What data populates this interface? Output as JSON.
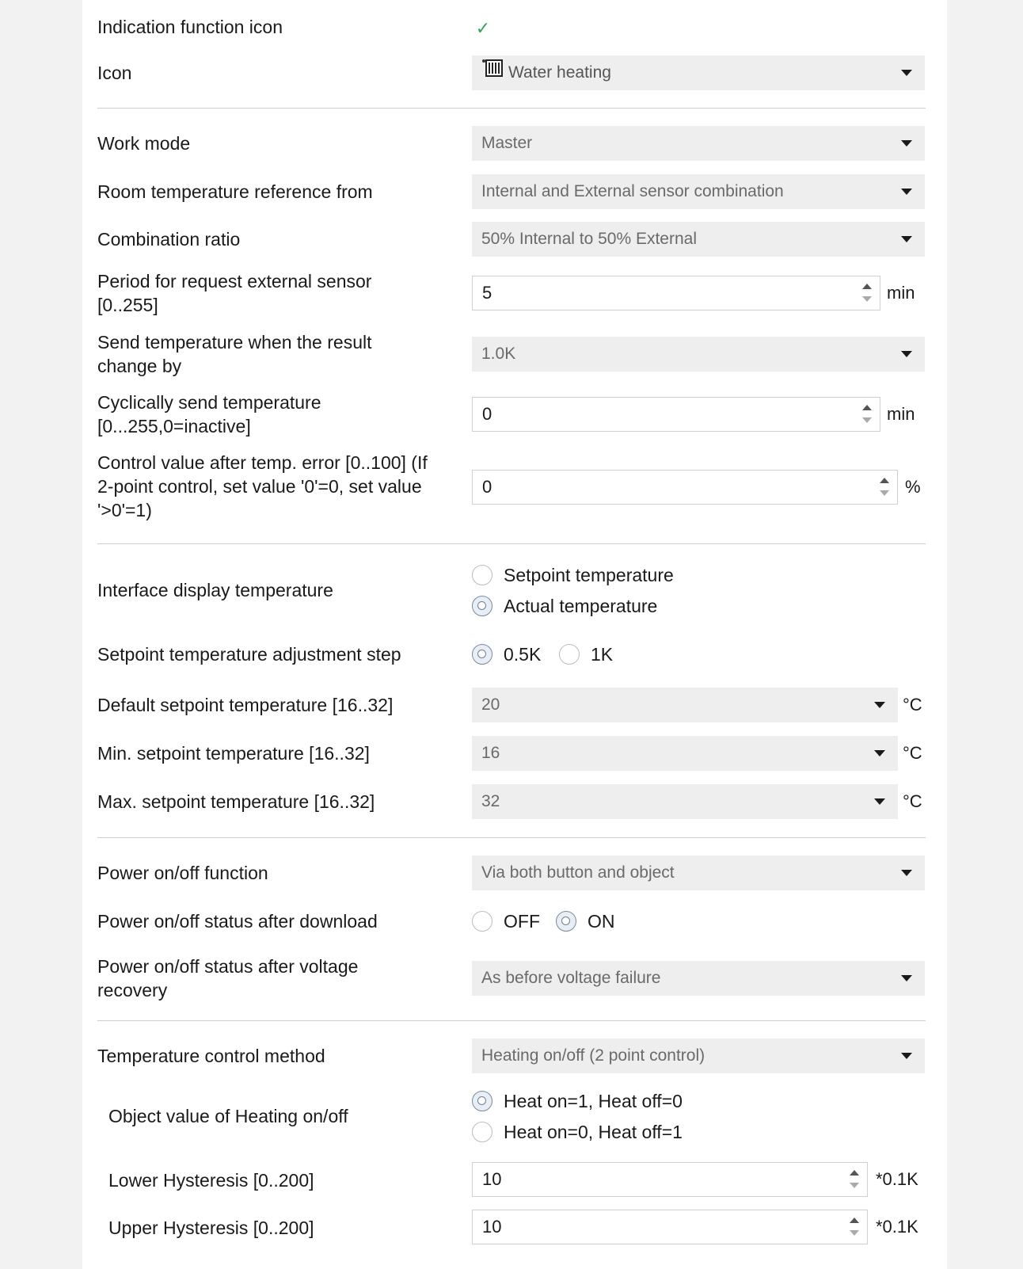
{
  "indication": {
    "label": "Indication function icon",
    "checked": true
  },
  "icon": {
    "label": "Icon",
    "value": "Water heating"
  },
  "work_mode": {
    "label": "Work mode",
    "value": "Master"
  },
  "room_ref": {
    "label": "Room temperature reference from",
    "value": "Internal and External sensor combination"
  },
  "combination": {
    "label": "Combination ratio",
    "value": "50% Internal to 50% External"
  },
  "period": {
    "label_1": "Period for request external sensor",
    "label_2": "[0..255]",
    "value": "5",
    "unit": "min"
  },
  "send_change": {
    "label_1": "Send temperature when the result",
    "label_2": "change by",
    "value": "1.0K"
  },
  "cyclic": {
    "label_1": "Cyclically send temperature",
    "label_2": "[0...255,0=inactive]",
    "value": "0",
    "unit": "min"
  },
  "control_err": {
    "label_1": "Control value after temp. error [0..100] (If",
    "label_2": "2-point control, set value '0'=0, set value",
    "label_3": "'>0'=1)",
    "value": "0",
    "unit": "%"
  },
  "display": {
    "label": "Interface display temperature",
    "options": [
      "Setpoint temperature",
      "Actual temperature"
    ],
    "selected": "Actual temperature"
  },
  "step": {
    "label": "Setpoint temperature adjustment step",
    "options": [
      "0.5K",
      "1K"
    ],
    "selected": "0.5K"
  },
  "default_sp": {
    "label": "Default setpoint temperature [16..32]",
    "value": "20",
    "unit": "°C"
  },
  "min_sp": {
    "label": "Min. setpoint temperature [16..32]",
    "value": "16",
    "unit": "°C"
  },
  "max_sp": {
    "label": "Max. setpoint temperature [16..32]",
    "value": "32",
    "unit": "°C"
  },
  "power_fn": {
    "label": "Power on/off function",
    "value": "Via both button and object"
  },
  "power_dl": {
    "label": "Power on/off status after download",
    "options": [
      "OFF",
      "ON"
    ],
    "selected": "ON"
  },
  "power_rec": {
    "label_1": "Power on/off status after voltage",
    "label_2": "recovery",
    "value": "As before voltage failure"
  },
  "ctrl_method": {
    "label": "Temperature control method",
    "value": "Heating on/off (2 point control)"
  },
  "obj_value": {
    "label": "Object value of Heating on/off",
    "options": [
      "Heat on=1, Heat off=0",
      "Heat on=0, Heat off=1"
    ],
    "selected": "Heat on=1, Heat off=0"
  },
  "lower_hyst": {
    "label": "Lower Hysteresis [0..200]",
    "value": "10",
    "unit": "*0.1K"
  },
  "upper_hyst": {
    "label": "Upper Hysteresis [0..200]",
    "value": "10",
    "unit": "*0.1K"
  }
}
